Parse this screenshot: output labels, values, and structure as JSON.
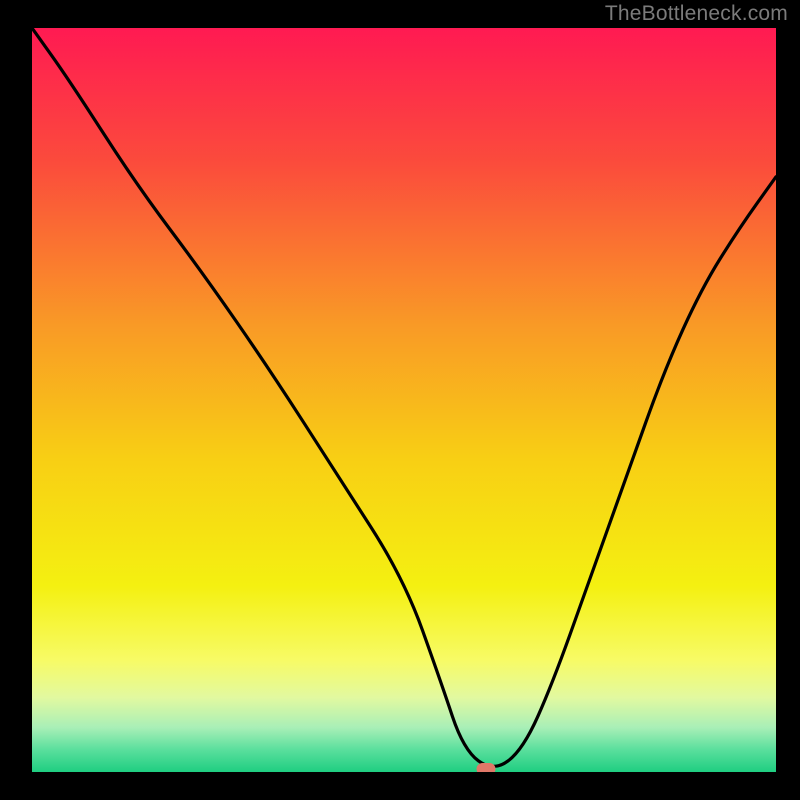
{
  "watermark": "TheBottleneck.com",
  "chart_data": {
    "type": "line",
    "title": "",
    "xlabel": "",
    "ylabel": "",
    "xlim": [
      0,
      100
    ],
    "ylim": [
      0,
      100
    ],
    "grid": false,
    "series": [
      {
        "name": "curve",
        "x_pct": [
          0,
          5,
          14,
          23,
          32,
          41,
          50,
          55,
          58,
          62,
          66,
          70,
          75,
          80,
          85,
          90,
          95,
          100
        ],
        "y_pct": [
          100,
          93,
          79,
          67,
          54,
          40,
          26,
          12,
          3,
          0,
          3,
          12,
          26,
          40,
          54,
          65,
          73,
          80
        ]
      }
    ],
    "marker": {
      "x_pct": 61,
      "y_pct": 0
    },
    "gradient_stops": [
      {
        "offset": 0,
        "color": "#ff1a52"
      },
      {
        "offset": 0.18,
        "color": "#fb4b3c"
      },
      {
        "offset": 0.4,
        "color": "#f99a26"
      },
      {
        "offset": 0.58,
        "color": "#f8cf14"
      },
      {
        "offset": 0.75,
        "color": "#f4f011"
      },
      {
        "offset": 0.85,
        "color": "#f7fb66"
      },
      {
        "offset": 0.9,
        "color": "#e2f9a0"
      },
      {
        "offset": 0.94,
        "color": "#a9efb7"
      },
      {
        "offset": 0.97,
        "color": "#5adf9d"
      },
      {
        "offset": 1.0,
        "color": "#1fce81"
      }
    ]
  }
}
